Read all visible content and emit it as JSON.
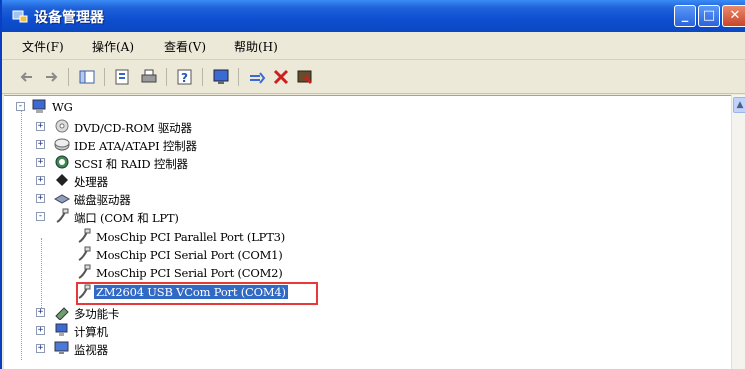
{
  "window": {
    "title": "设备管理器",
    "buttons": {
      "minimize": "_",
      "maximize": "□",
      "close": "✕"
    }
  },
  "menu": [
    {
      "label": "文件(F)"
    },
    {
      "label": "操作(A)"
    },
    {
      "label": "查看(V)"
    },
    {
      "label": "帮助(H)"
    }
  ],
  "toolbar": {
    "icons": [
      "back-arrow-icon",
      "forward-arrow-icon",
      "show-hide-tree-icon",
      "properties-icon",
      "print-icon",
      "help-icon",
      "scan-hardware-icon",
      "update-driver-icon",
      "uninstall-icon",
      "disable-icon"
    ]
  },
  "tree": {
    "root": "WG",
    "categories": [
      {
        "label": "DVD/CD-ROM 驱动器",
        "expander": "+"
      },
      {
        "label": "IDE ATA/ATAPI 控制器",
        "expander": "+"
      },
      {
        "label": "SCSI 和 RAID 控制器",
        "expander": "+"
      },
      {
        "label": "处理器",
        "expander": "+"
      },
      {
        "label": "磁盘驱动器",
        "expander": "+"
      },
      {
        "label": "端口 (COM 和 LPT)",
        "expander": "-"
      },
      {
        "label": "多功能卡",
        "expander": "+"
      },
      {
        "label": "计算机",
        "expander": "+"
      },
      {
        "label": "监视器",
        "expander": "+"
      }
    ],
    "ports": [
      {
        "label": "MosChip PCI Parallel Port (LPT3)"
      },
      {
        "label": "MosChip PCI Serial Port (COM1)"
      },
      {
        "label": "MosChip PCI Serial Port (COM2)"
      },
      {
        "label": "ZM2604 USB VCom Port (COM4)"
      }
    ],
    "selected_index": 3
  },
  "colors": {
    "titlebar": "#0b47c3",
    "selection": "#316ac5",
    "highlight": "#e8393a"
  }
}
